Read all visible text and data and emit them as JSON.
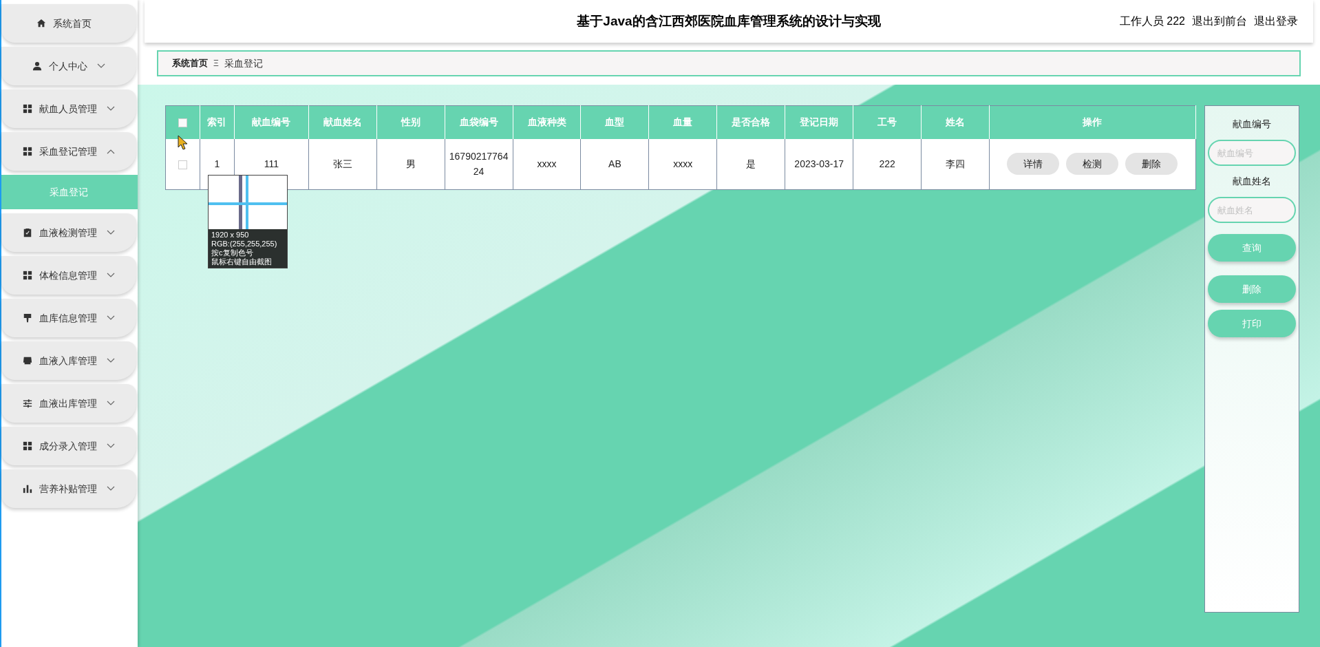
{
  "sidebar": {
    "items": [
      {
        "label": "系统首页",
        "kind": "link"
      },
      {
        "label": "个人中心",
        "kind": "submenu",
        "expanded": false
      },
      {
        "label": "献血人员管理",
        "kind": "submenu",
        "expanded": false
      },
      {
        "label": "采血登记管理",
        "kind": "submenu",
        "expanded": true,
        "children": [
          {
            "label": "采血登记",
            "selected": true
          }
        ]
      },
      {
        "label": "血液检测管理",
        "kind": "submenu",
        "expanded": false
      },
      {
        "label": "体检信息管理",
        "kind": "submenu",
        "expanded": false
      },
      {
        "label": "血库信息管理",
        "kind": "submenu",
        "expanded": false
      },
      {
        "label": "血液入库管理",
        "kind": "submenu",
        "expanded": false
      },
      {
        "label": "血液出库管理",
        "kind": "submenu",
        "expanded": false
      },
      {
        "label": "成分录入管理",
        "kind": "submenu",
        "expanded": false
      },
      {
        "label": "营养补贴管理",
        "kind": "submenu",
        "expanded": false
      }
    ]
  },
  "header": {
    "title": "基于Java的含江西郊医院血库管理系统的设计与实现",
    "user": "工作人员 222",
    "links": [
      "退出到前台",
      "退出登录"
    ]
  },
  "breadcrumb": {
    "items": [
      "系统首页",
      "采血登记"
    ],
    "separator": "Ξ"
  },
  "table": {
    "select_all": {
      "checked": false
    },
    "columns": [
      "索引",
      "献血编号",
      "献血姓名",
      "性别",
      "血袋编号",
      "血液种类",
      "血型",
      "血量",
      "是否合格",
      "登记日期",
      "工号",
      "姓名",
      "操作"
    ],
    "rows": [
      {
        "checked": false,
        "cells": [
          "1",
          "111",
          "张三",
          "男",
          "1679021776424",
          "xxxx",
          "AB",
          "xxxx",
          "是",
          "2023-03-17",
          "222",
          "李四"
        ],
        "actions": [
          "详情",
          "检测",
          "删除"
        ]
      }
    ]
  },
  "search_panel": {
    "fields": [
      {
        "label": "献血编号",
        "placeholder": "献血编号"
      },
      {
        "label": "献血姓名",
        "placeholder": "献血姓名"
      }
    ],
    "buttons": [
      "查询",
      "删除",
      "打印"
    ]
  },
  "screenshot_tool": {
    "lines": [
      "1920 x 950",
      "RGB:(255,255,255)",
      "按c复制色号",
      "鼠标右键自由截图"
    ]
  }
}
